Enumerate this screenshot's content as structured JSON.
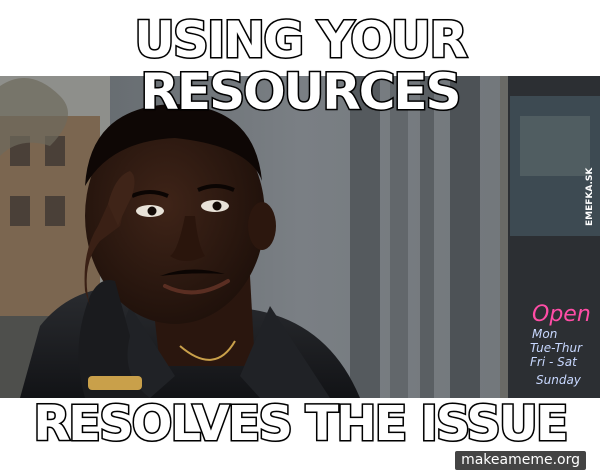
{
  "meme": {
    "top_line_1": "USING YOUR",
    "top_line_2": "RESOURCES",
    "bottom_text": "RESOLVES THE ISSUE",
    "watermark_site": "makeameme.org",
    "watermark_side": "EMEFKA.SK"
  },
  "sign": {
    "title": "Open",
    "line_1": "Mon",
    "line_2": "Tue-Thur",
    "line_3": "Fri - Sat",
    "line_4": "Sunday"
  },
  "colors": {
    "caption_fill": "#ffffff",
    "caption_stroke": "#000000",
    "sign_neon": "#ff4da6",
    "sign_text": "#c8d8ff"
  },
  "image_description_icon": "man-tapping-temple-photo"
}
